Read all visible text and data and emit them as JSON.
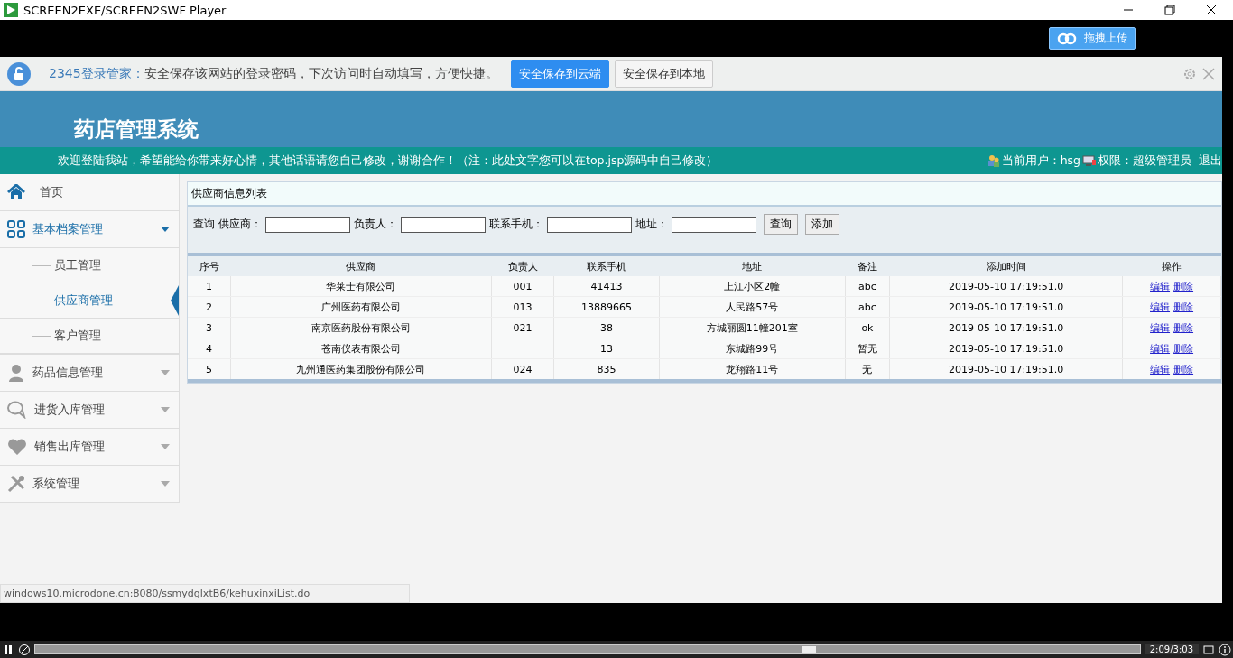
{
  "window": {
    "title": "SCREEN2EXE/SCREEN2SWF Player"
  },
  "upload_button": "拖拽上传",
  "password_bar": {
    "brand": "2345登录管家：",
    "message": "安全保存该网站的登录密码，下次访问时自动填写，方便快捷。",
    "buttons": [
      {
        "label": "安全保存到云端",
        "primary": true
      },
      {
        "label": "安全保存到本地",
        "primary": false
      }
    ]
  },
  "header": {
    "title": "药店管理系统"
  },
  "notice": {
    "text": "欢迎登陆我站，希望能给你带来好心情，其他话语请您自己修改，谢谢合作！（注：此处文字您可以在top.jsp源码中自己修改）",
    "user": "当前用户：hsg",
    "role": "权限：超级管理员",
    "logout": "退出"
  },
  "sidebar": {
    "items": [
      {
        "kind": "link",
        "label": "首页",
        "selected": false
      },
      {
        "kind": "group",
        "label": "基本档案管理",
        "selected": true,
        "expanded": true,
        "children": [
          {
            "label": "员工管理",
            "selected": false
          },
          {
            "label": "供应商管理",
            "selected": true
          },
          {
            "label": "客户管理",
            "selected": false
          }
        ]
      },
      {
        "kind": "group",
        "label": "药品信息管理",
        "selected": false,
        "expanded": false
      },
      {
        "kind": "group",
        "label": "进货入库管理",
        "selected": false,
        "expanded": false
      },
      {
        "kind": "group",
        "label": "销售出库管理",
        "selected": false,
        "expanded": false
      },
      {
        "kind": "group",
        "label": "系统管理",
        "selected": false,
        "expanded": false
      }
    ]
  },
  "panel": {
    "title": "供应商信息列表",
    "search": {
      "label": "查询",
      "fields": [
        "供应商：",
        "负责人：",
        "联系手机：",
        "地址："
      ],
      "buttons": [
        "查询",
        "添加"
      ]
    },
    "table": {
      "columns": [
        "序号",
        "供应商",
        "负责人",
        "联系手机",
        "地址",
        "备注",
        "添加时间",
        "操作"
      ],
      "rows": [
        {
          "no": "1",
          "supplier": "华莱士有限公司",
          "contact": "001",
          "phone": "41413",
          "address": "上江小区2幢",
          "note": "abc",
          "time": "2019-05-10 17:19:51.0",
          "actions": [
            "编辑",
            "删除"
          ]
        },
        {
          "no": "2",
          "supplier": "广州医药有限公司",
          "contact": "013",
          "phone": "13889665",
          "address": "人民路57号",
          "note": "abc",
          "time": "2019-05-10 17:19:51.0",
          "actions": [
            "编辑",
            "删除"
          ]
        },
        {
          "no": "3",
          "supplier": "南京医药股份有限公司",
          "contact": "021",
          "phone": "38",
          "address": "方城丽圆11幢201室",
          "note": "ok",
          "time": "2019-05-10 17:19:51.0",
          "actions": [
            "编辑",
            "删除"
          ]
        },
        {
          "no": "4",
          "supplier": "苍南仪表有限公司",
          "phone": "13",
          "address": "东城路99号",
          "note": "暂无",
          "time": "2019-05-10 17:19:51.0",
          "actions": [
            "编辑",
            "删除"
          ]
        },
        {
          "no": "5",
          "supplier": "九州通医药集团股份有限公司",
          "contact": "024",
          "phone": "835",
          "address": "龙翔路11号",
          "note": "无",
          "time": "2019-05-10 17:19:51.0",
          "actions": [
            "编辑",
            "删除"
          ]
        }
      ]
    }
  },
  "status_url": "windows10.microdone.cn:8080/ssmydglxtB6/kehuxinxiList.do",
  "player": {
    "level": 0.7,
    "time": "2:09/3:03"
  }
}
